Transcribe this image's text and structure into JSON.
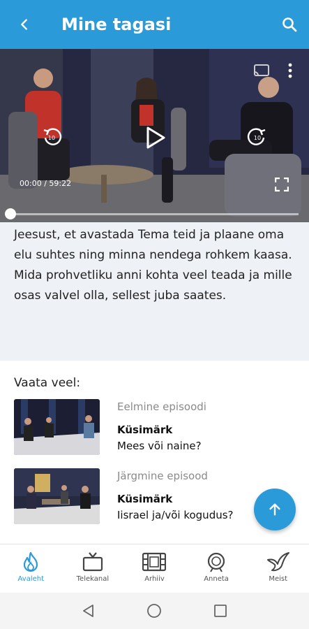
{
  "appbar": {
    "title": "Mine tagasi",
    "back_icon": "arrow-back-icon",
    "search_icon": "search-icon",
    "color": "#2b9ad8"
  },
  "player": {
    "time": "00:00 / 59:22",
    "progress": 0,
    "icons": [
      "cast-icon",
      "more-vertical-icon",
      "replay-10-icon",
      "play-icon",
      "forward-10-icon",
      "fullscreen-icon"
    ]
  },
  "description": {
    "text": "Jeesust, et avastada Tema teid ja plaane oma elu suhtes ning minna nendega rohkem kaasa. Mida prohvetliku anni kohta veel teada ja mille osas valvel olla, sellest juba saates."
  },
  "more": {
    "header": "Vaata veel:",
    "episodes": [
      {
        "kind": "Eelmine episoodi",
        "show": "Küsimärk",
        "name": "Mees või naine?"
      },
      {
        "kind": "Järgmine episood",
        "show": "Küsimärk",
        "name": "Iisrael ja/või kogudus?"
      }
    ]
  },
  "fab": {
    "icon": "arrow-up-icon"
  },
  "tabs": [
    {
      "label": "Avaleht",
      "icon": "flame-icon",
      "active": true
    },
    {
      "label": "Telekanal",
      "icon": "tv-icon",
      "active": false
    },
    {
      "label": "Arhiiv",
      "icon": "film-icon",
      "active": false
    },
    {
      "label": "Anneta",
      "icon": "donate-icon",
      "active": false
    },
    {
      "label": "Meist",
      "icon": "bird-icon",
      "active": false
    }
  ],
  "accent_color": "#2b9ad8"
}
